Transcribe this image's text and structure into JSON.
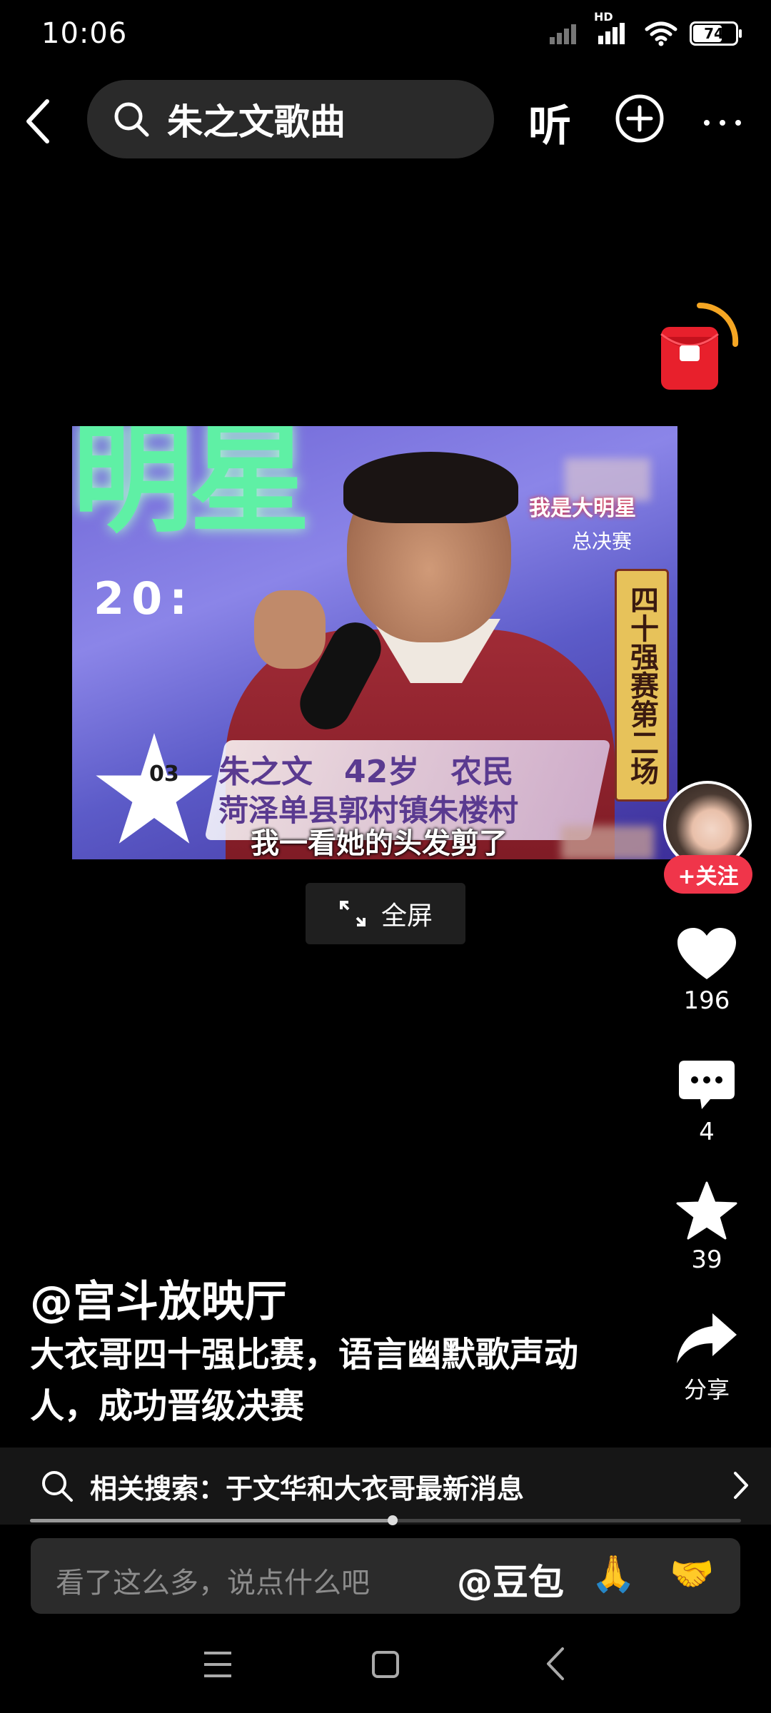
{
  "status_bar": {
    "time": "10:06",
    "network_label": "HD",
    "battery": 74
  },
  "top_nav": {
    "search_query": "朱之文歌曲",
    "listen_label": "听"
  },
  "video": {
    "overlay_title": "明星",
    "overlay_time": "20:",
    "show_logo": "我是大明星",
    "show_sub": "总决赛",
    "side_panel": "四十强赛第二场",
    "contestant_number": "03",
    "info_line1": "朱之文　42岁　农民",
    "info_line2": "菏泽单县郭村镇朱楼村",
    "subtitle": "我一看她的头发剪了"
  },
  "fullscreen": {
    "label": "全屏"
  },
  "actions": {
    "follow_label": "+关注",
    "like_count": "196",
    "comment_count": "4",
    "favorite_count": "39",
    "share_label": "分享"
  },
  "post": {
    "author": "@宫斗放映厅",
    "caption": "大衣哥四十强比赛，语言幽默歌声动人，成功晋级决赛"
  },
  "related_search": {
    "text": "相关搜索：于文华和大衣哥最新消息"
  },
  "progress": {
    "played_fraction": 0.51
  },
  "comment_bar": {
    "placeholder": "看了这么多，说点什么吧",
    "mention": "@豆包",
    "emoji_1": "🙏",
    "emoji_2": "🤝"
  },
  "colors": {
    "background": "#000000",
    "follow_button": "#f0354a",
    "red_packet": "#e8202c",
    "red_packet_ring": "#f5a623"
  }
}
